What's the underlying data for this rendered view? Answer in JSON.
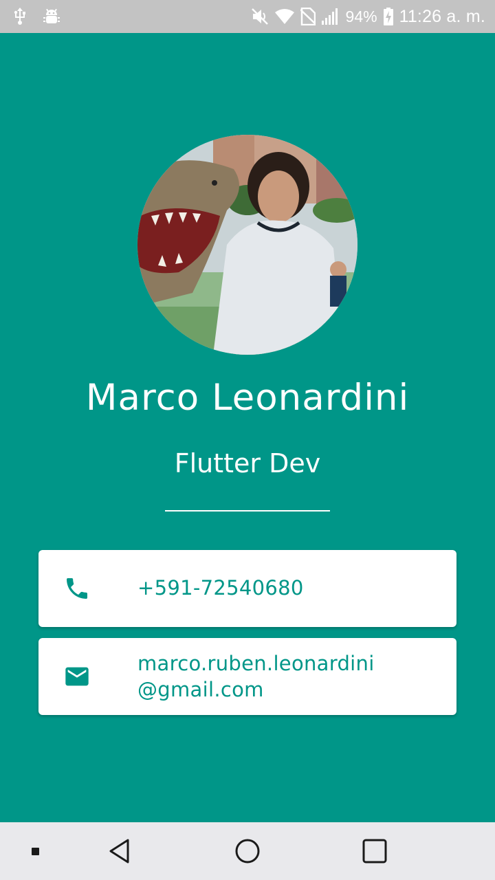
{
  "status_bar": {
    "battery_percent": "94%",
    "time": "11:26 a. m.",
    "icons": [
      "usb-icon",
      "android-debug-icon",
      "mute-icon",
      "wifi-icon",
      "no-sim-icon",
      "signal-icon",
      "battery-charging-icon"
    ]
  },
  "profile": {
    "name": "Marco Leonardini",
    "role": "Flutter Dev",
    "avatar_icon": "profile-photo"
  },
  "contacts": {
    "phone": {
      "icon": "phone-icon",
      "value": "+591-72540680"
    },
    "email": {
      "icon": "email-icon",
      "line1": "marco.ruben.leonardini",
      "line2": "@gmail.com"
    }
  },
  "nav_bar": {
    "icons": [
      "dot-icon",
      "back-icon",
      "home-icon",
      "recents-icon"
    ]
  },
  "colors": {
    "background": "#009688",
    "accent": "#009688",
    "card": "#ffffff",
    "status_bar": "#c3c3c3",
    "nav_bar": "#e9e9ec"
  }
}
